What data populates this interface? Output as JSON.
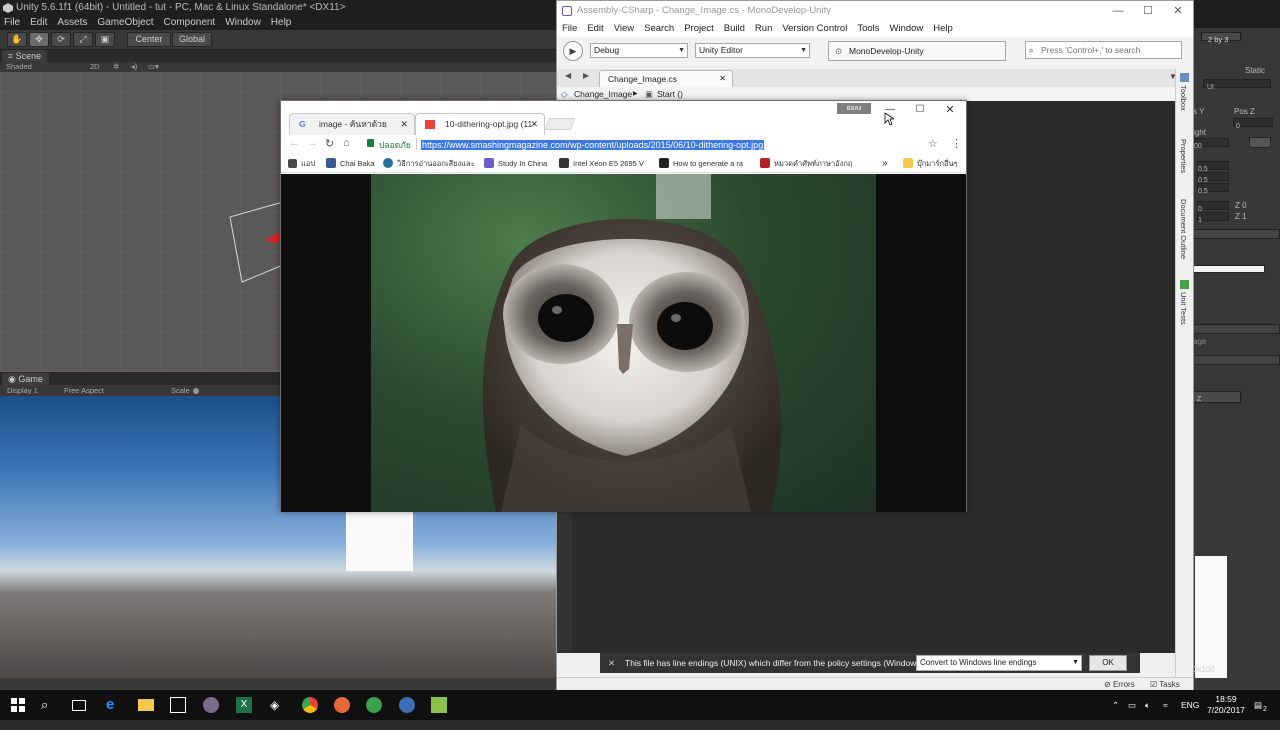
{
  "unity": {
    "title": "Unity 5.6.1f1 (64bit) - Untitled - tut - PC, Mac & Linux Standalone* <DX11>",
    "menu": [
      "File",
      "Edit",
      "Assets",
      "GameObject",
      "Component",
      "Window",
      "Help"
    ],
    "toolbar": {
      "center_label": "Center",
      "global_label": "Global",
      "layout_label": "2 by 3"
    },
    "scene": {
      "tab_label": "Scene",
      "shading_mode": "Shaded",
      "twod_label": "2D"
    },
    "game": {
      "tab_label": "Game",
      "display_label": "Display 1",
      "aspect_label": "Free Aspect",
      "scale_label": "Scale"
    },
    "inspector": {
      "static_label": "Static",
      "layer_value": "UI",
      "pos_y_label": "s Y",
      "pos_z_label": "Pos Z",
      "pos_z_value": "0",
      "height_label": "ight",
      "height_value": "00",
      "pivot_values": [
        "0.5",
        "0.5",
        "0.5"
      ],
      "rot_values": [
        "0",
        "1"
      ],
      "z_labels": [
        "Z 0",
        "Z 1"
      ],
      "image_label": "age",
      "z_button_label": "Z",
      "bottom_value": "0x100"
    }
  },
  "monodevelop": {
    "title": "Assembly-CSharp - Change_Image.cs - MonoDevelop-Unity",
    "menu": [
      "File",
      "Edit",
      "View",
      "Search",
      "Project",
      "Build",
      "Run",
      "Version Control",
      "Tools",
      "Window",
      "Help"
    ],
    "config": "Debug",
    "target": "Unity Editor",
    "status_text": "MonoDevelop-Unity",
    "search_placeholder": "Press 'Control+,' to search",
    "file_tab": "Change_Image.cs",
    "path_class": "Change_Image",
    "path_method": "Start ()",
    "side_labels": [
      "Toolbox",
      "Properties",
      "Document Outline",
      "Unit Tests"
    ],
    "info_message": "This file has line endings (UNIX) which differ from the policy settings (Windows).",
    "info_option": "Convert to Windows line endings",
    "ok_label": "OK",
    "errors_label": "Errors",
    "tasks_label": "Tasks"
  },
  "chrome": {
    "tabs": [
      {
        "title": "image - ค้นหาด้วย Google"
      },
      {
        "title": "10-dithering-opt.jpg (11"
      }
    ],
    "restore_tooltip": "ย่อลง",
    "security_label": "ปลอดภัย",
    "url": "https://www.smashingmagazine.com/wp-content/uploads/2015/06/10-dithering-opt.jpg",
    "bookmarks": [
      {
        "label": "แอป",
        "icon": "apps-grid-icon",
        "color": "#4a4a4a"
      },
      {
        "label": "Chai Baka",
        "icon": "facebook-icon",
        "color": "#3b5998"
      },
      {
        "label": "วิธีการอ่านออกเสียงและ",
        "icon": "wordpress-icon",
        "color": "#21759b"
      },
      {
        "label": "Study In China",
        "icon": "study-icon",
        "color": "#6a5acd"
      },
      {
        "label": "Intel Xeon E5 2695 V",
        "icon": "intel-icon",
        "color": "#333333"
      },
      {
        "label": "How to generate a ra",
        "icon": "unity-icon",
        "color": "#222222"
      },
      {
        "label": "หมวดคำศัพท์ภาษาอังกฤ",
        "icon": "dictionary-icon",
        "color": "#b22222"
      }
    ],
    "bookmarks_more": "»",
    "bookmark_folder": "บุ๊กมาร์กอื่นๆ"
  },
  "taskbar": {
    "language": "ENG",
    "time": "18:59",
    "date": "7/20/2017",
    "notification_count": "2"
  }
}
